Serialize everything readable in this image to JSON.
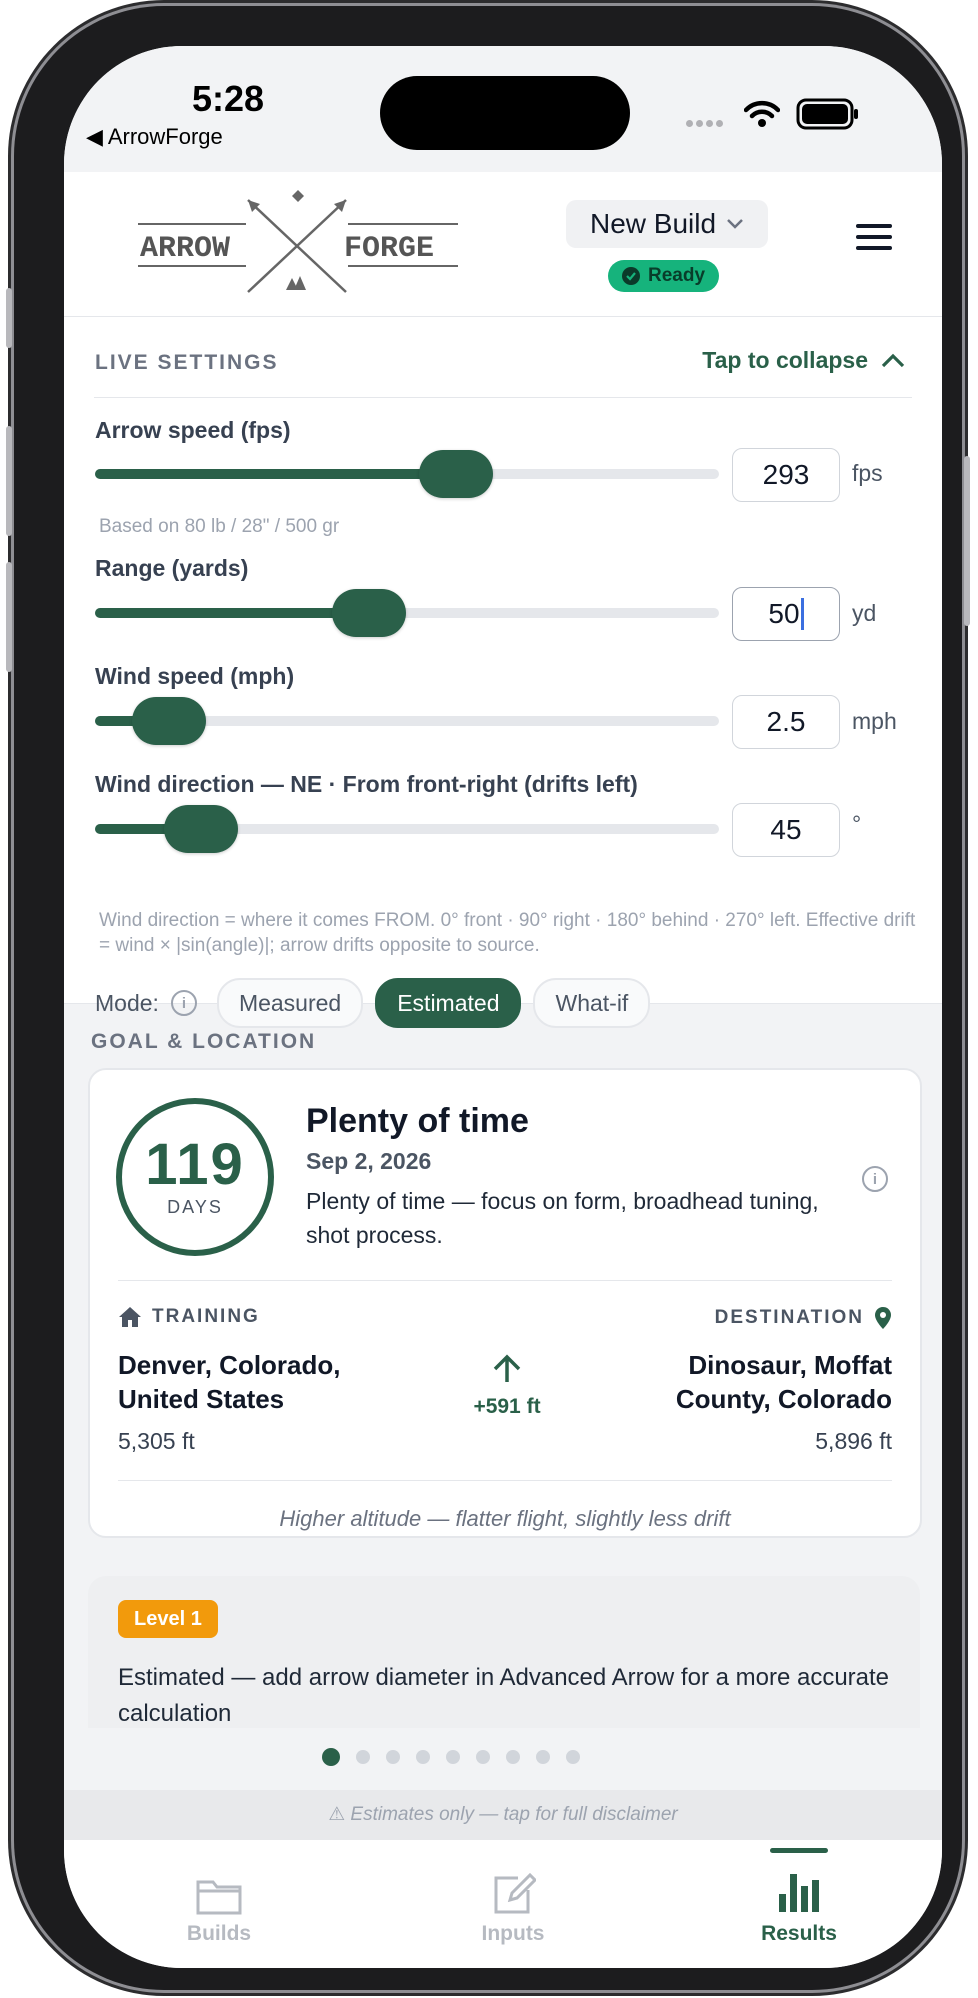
{
  "status": {
    "time": "5:28",
    "back_app": "ArrowForge"
  },
  "header": {
    "logo_left": "ARROW",
    "logo_right": "FORGE",
    "build_select": "New Build",
    "status_badge": "Ready"
  },
  "live": {
    "title": "LIVE SETTINGS",
    "collapse": "Tap to collapse",
    "sliders": [
      {
        "label": "Arrow speed (fps)",
        "value": "293",
        "unit": "fps",
        "fraction": 0.52,
        "hint": "Based on 80 lb / 28\" / 500 gr"
      },
      {
        "label": "Range (yards)",
        "value": "50",
        "unit": "yd",
        "fraction": 0.38
      },
      {
        "label": "Wind speed (mph)",
        "value": "2.5",
        "unit": "mph",
        "fraction": 0.06
      },
      {
        "label": "Wind direction — NE · From front-right (drifts left)",
        "value": "45",
        "unit": "°",
        "fraction": 0.11
      }
    ],
    "help": "Wind direction = where it comes FROM. 0° front · 90° right · 180° behind · 270° left. Effective drift = wind × |sin(angle)|; arrow drifts opposite to source.",
    "mode_label": "Mode:",
    "modes": [
      "Measured",
      "Estimated",
      "What-if"
    ],
    "active_mode": "Estimated"
  },
  "goal": {
    "title": "GOAL & LOCATION",
    "days": "119",
    "days_label": "DAYS",
    "heading": "Plenty of time",
    "date": "Sep 2, 2026",
    "desc": "Plenty of time — focus on form, broadhead tuning, shot process.",
    "training_label": "TRAINING",
    "training_place": "Denver, Colorado, United States",
    "training_alt": "5,305 ft",
    "elevation_change": "+591 ft",
    "destination_label": "DESTINATION",
    "destination_place": "Dinosaur, Moffat County, Colorado",
    "destination_alt": "5,896 ft",
    "note": "Higher altitude — flatter flight, slightly less drift"
  },
  "level": {
    "badge": "Level 1",
    "text": "Estimated — add arrow diameter in Advanced Arrow for a more accurate calculation"
  },
  "pager": {
    "count": 9,
    "active": 1
  },
  "disclaimer": "Estimates only — tap for full disclaimer",
  "tabs": [
    {
      "label": "Builds",
      "icon": "folder-icon"
    },
    {
      "label": "Inputs",
      "icon": "edit-icon"
    },
    {
      "label": "Results",
      "icon": "bar-chart-icon"
    }
  ],
  "active_tab": "Results",
  "colors": {
    "accent": "#2a6049",
    "ready": "#16b37c",
    "level": "#f29a0c"
  }
}
